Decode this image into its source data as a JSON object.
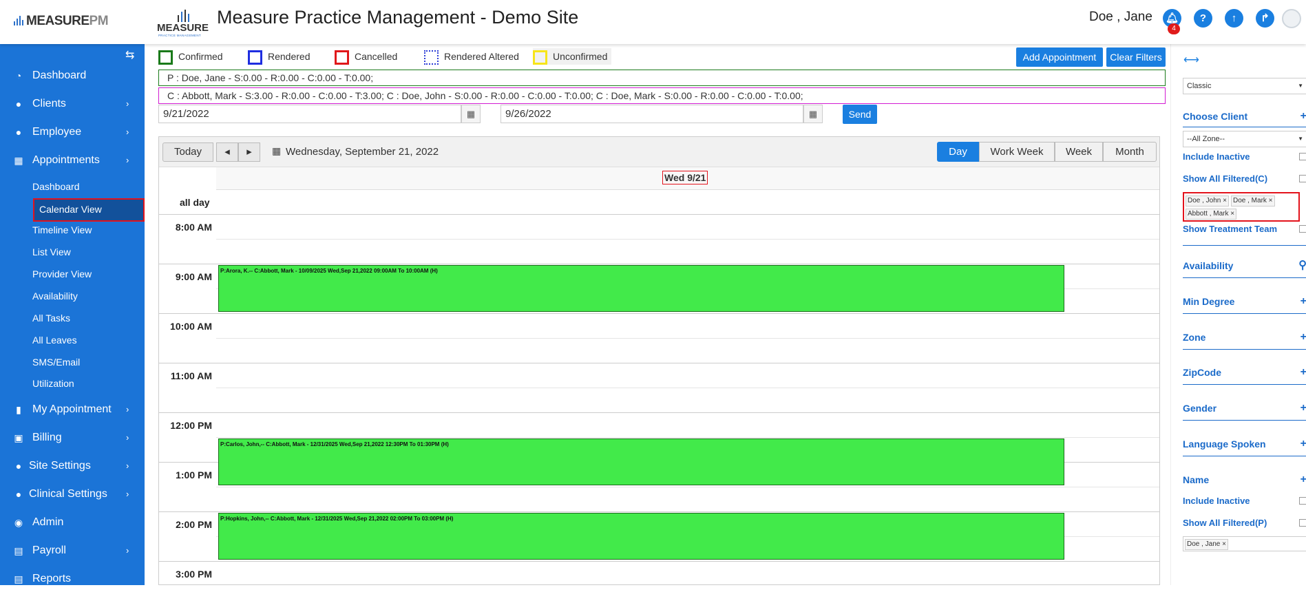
{
  "header": {
    "brand_main": "MEASURE",
    "brand_pm": "PM",
    "logo_word": "MEASURE",
    "logo_sub": "PRACTICE MANAGEMENT",
    "title": "Measure Practice Management - Demo Site",
    "user_name": "Doe , Jane",
    "notification_count": "4"
  },
  "sidebar": {
    "items": [
      {
        "label": "Dashboard"
      },
      {
        "label": "Clients"
      },
      {
        "label": "Employee"
      },
      {
        "label": "Appointments"
      },
      {
        "label": "My Appointment"
      },
      {
        "label": "Billing"
      },
      {
        "label": "Site Settings"
      },
      {
        "label": "Clinical Settings"
      },
      {
        "label": "Admin"
      },
      {
        "label": "Payroll"
      },
      {
        "label": "Reports"
      }
    ],
    "sub_items": [
      "Dashboard",
      "Calendar View",
      "Timeline View",
      "List View",
      "Provider View",
      "Availability",
      "All Tasks",
      "All Leaves",
      "SMS/Email",
      "Utilization"
    ]
  },
  "legend": {
    "confirmed": "Confirmed",
    "rendered": "Rendered",
    "cancelled": "Cancelled",
    "rendered_altered": "Rendered Altered",
    "unconfirmed": "Unconfirmed"
  },
  "colors": {
    "confirmed": "#1a7a1a",
    "rendered": "#1f2ee0",
    "cancelled": "#e0181b",
    "rendered_altered": "#2a3bd6",
    "unconfirmed": "#f7e51a",
    "sidebar": "#1b74d7",
    "event": "#42ea4a"
  },
  "actions": {
    "add_appointment": "Add Appointment",
    "clear_filters": "Clear Filters",
    "send": "Send"
  },
  "summary": {
    "provider_line": "P : Doe, Jane - S:0.00 - R:0.00 - C:0.00 - T:0.00;",
    "client_line": "C : Abbott, Mark - S:3.00 - R:0.00 - C:0.00 - T:3.00; C : Doe, John - S:0.00 - R:0.00 - C:0.00 - T:0.00; C : Doe, Mark - S:0.00 - R:0.00 - C:0.00 - T:0.00;"
  },
  "date_range": {
    "start": "9/21/2022",
    "end": "9/26/2022"
  },
  "calendar": {
    "today_label": "Today",
    "prev": "◂",
    "next": "▸",
    "current_date": "Wednesday, September 21, 2022",
    "views": [
      "Day",
      "Work Week",
      "Week",
      "Month"
    ],
    "active_view": "Day",
    "day_header": "Wed 9/21",
    "all_day_label": "all day",
    "time_slots": [
      "8:00 AM",
      "9:00 AM",
      "10:00 AM",
      "11:00 AM",
      "12:00 PM",
      "1:00 PM",
      "2:00 PM",
      "3:00 PM"
    ],
    "events": [
      {
        "text": "P:Arora, K.-- C:Abbott, Mark - 10/09/2025 Wed,Sep 21,2022 09:00AM To 10:00AM (H)"
      },
      {
        "text": "P:Carlos, John,-- C:Abbott, Mark - 12/31/2025 Wed,Sep 21,2022 12:30PM To 01:30PM (H)"
      },
      {
        "text": "P:Hopkins, John,-- C:Abbott, Mark - 12/31/2025 Wed,Sep 21,2022 02:00PM To 03:00PM (H)"
      }
    ]
  },
  "right_panel": {
    "theme_select": "Classic",
    "choose_client": "Choose Client",
    "zone_select": "--All Zone--",
    "include_inactive": "Include Inactive",
    "show_all_filtered_c": "Show All Filtered(C)",
    "client_tags": [
      "Doe , John",
      "Doe , Mark",
      "Abbott , Mark"
    ],
    "show_treatment_team": "Show Treatment Team",
    "availability": "Availability",
    "min_degree": "Min Degree",
    "zone": "Zone",
    "zipcode": "ZipCode",
    "gender": "Gender",
    "language_spoken": "Language Spoken",
    "name": "Name",
    "include_inactive_p": "Include Inactive",
    "show_all_filtered_p": "Show All Filtered(P)",
    "provider_tags": [
      "Doe , Jane"
    ]
  }
}
